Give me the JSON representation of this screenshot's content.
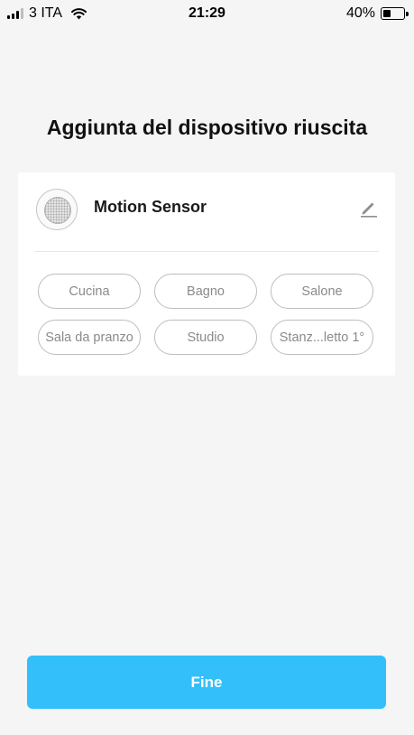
{
  "status_bar": {
    "carrier": "3 ITA",
    "time": "21:29",
    "battery_percent": "40%",
    "battery_level": 0.4
  },
  "title": "Aggiunta del dispositivo riuscita",
  "device": {
    "name": "Motion Sensor",
    "icon": "motion-sensor-icon"
  },
  "rooms": [
    "Cucina",
    "Bagno",
    "Salone",
    "Sala da pranzo",
    "Studio",
    "Stanz...letto 1°"
  ],
  "done_button": {
    "label": "Fine"
  },
  "colors": {
    "accent": "#33bff9",
    "background": "#f5f5f5",
    "card": "#ffffff",
    "chip_border": "#bdbdbd",
    "chip_text": "#8a8a8a"
  }
}
